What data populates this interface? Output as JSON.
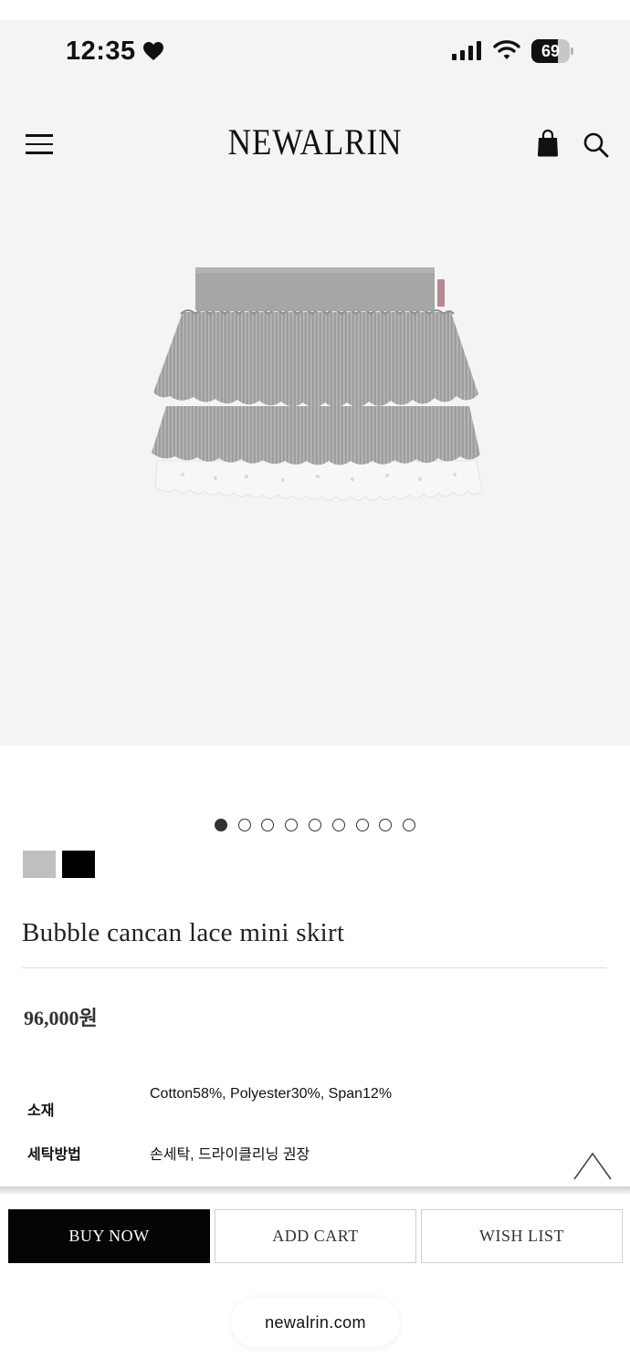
{
  "status_bar": {
    "time": "12:35",
    "battery_level": "69",
    "battery_percent": 69,
    "icons": [
      "heart-icon",
      "cellular-signal-icon",
      "wifi-icon",
      "battery-icon"
    ]
  },
  "header": {
    "brand": "NEWALRIN",
    "icons": [
      "menu-icon",
      "shopping-bag-icon",
      "search-icon"
    ]
  },
  "carousel": {
    "total": 9,
    "active_index": 0
  },
  "color_swatches": [
    {
      "name": "gray",
      "color": "#bfbfbf"
    },
    {
      "name": "black",
      "color": "#000000"
    }
  ],
  "product": {
    "name": "Bubble cancan lace mini skirt",
    "price": "96,000원"
  },
  "specs": [
    {
      "label": "소재",
      "value": "Cotton58%, Polyester30%, Span12%"
    },
    {
      "label": "세탁방법",
      "value": "손세탁, 드라이클리닝 권장"
    }
  ],
  "actions": {
    "buy_now": "BUY NOW",
    "add_cart": "ADD CART",
    "wish_list": "WISH LIST"
  },
  "browser": {
    "url": "newalrin.com"
  },
  "colors": {
    "background": "#ffffff",
    "panel": "#f4f4f4",
    "primary": "#050505",
    "border": "#cfcfcf"
  }
}
